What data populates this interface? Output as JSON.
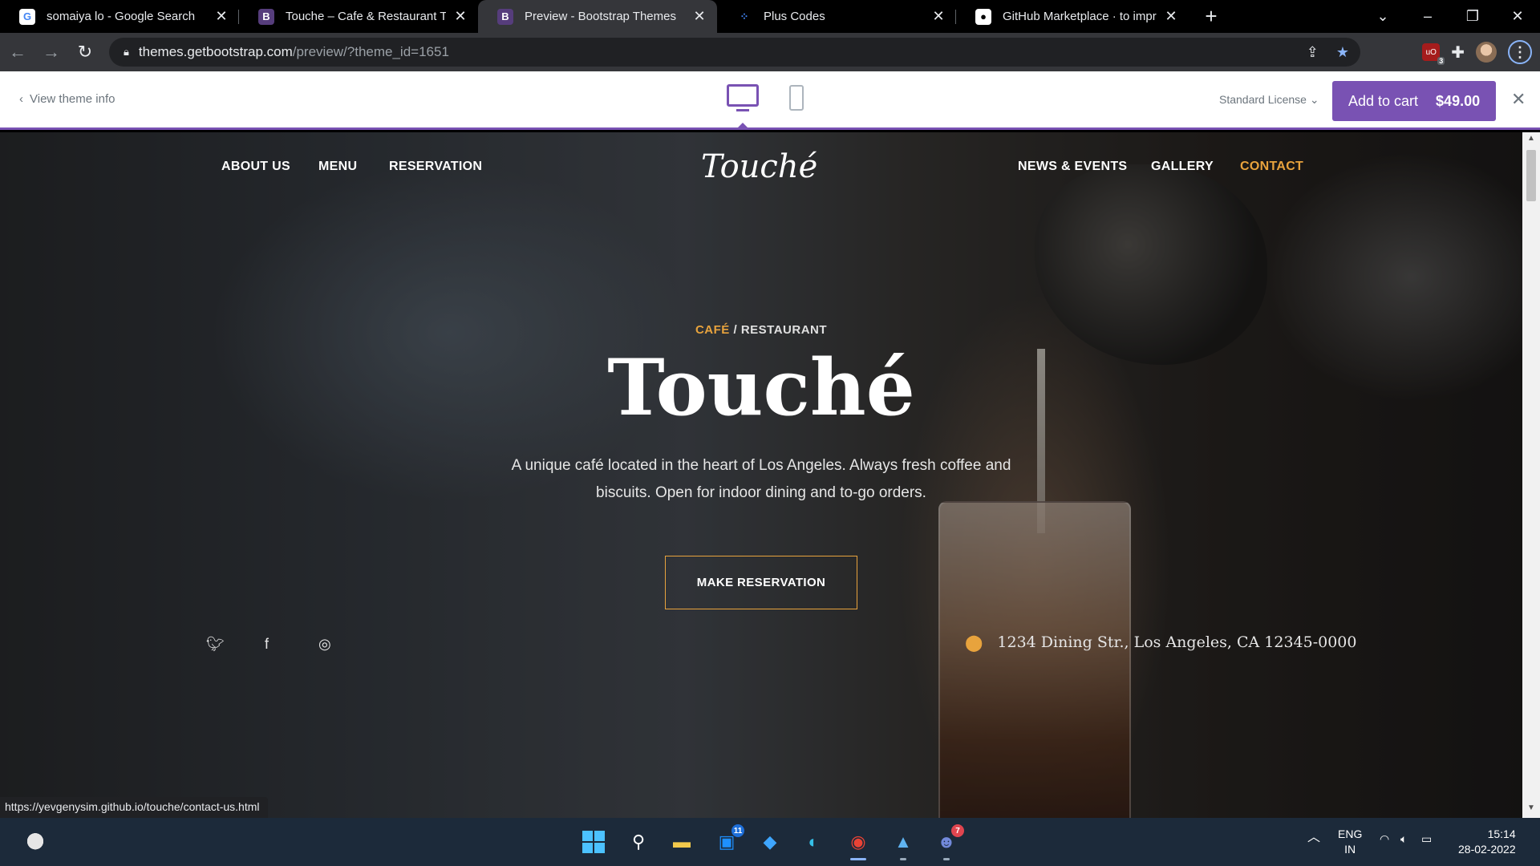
{
  "browser": {
    "tabs": [
      {
        "title": "somaiya lo - Google Search",
        "favicon": "google-icon"
      },
      {
        "title": "Touche – Cafe & Restaurant Theme",
        "favicon": "bootstrap-icon"
      },
      {
        "title": "Preview - Bootstrap Themes",
        "favicon": "bootstrap-icon",
        "active": true
      },
      {
        "title": "Plus Codes",
        "favicon": "plus-codes-icon"
      },
      {
        "title": "GitHub Marketplace · to improve",
        "favicon": "github-icon"
      }
    ],
    "url_host": "themes.getbootstrap.com",
    "url_path": "/preview/?theme_id=1651",
    "extension_badge": "3",
    "status_url": "https://yevgenysim.github.io/touche/contact-us.html"
  },
  "preview_bar": {
    "view_info": "View theme info",
    "license": "Standard License",
    "cart_label": "Add to cart",
    "price": "$49.00",
    "accent_color": "#7952b3"
  },
  "site": {
    "logo": "Touché",
    "nav_left": [
      "ABOUT US",
      "MENU",
      "RESERVATION"
    ],
    "nav_right": [
      "NEWS & EVENTS",
      "GALLERY",
      "CONTACT"
    ],
    "active_nav": "CONTACT",
    "accent_color": "#e8a33d",
    "eyebrow_a": "CAFÉ",
    "eyebrow_sep": " / ",
    "eyebrow_b": "RESTAURANT",
    "title": "Touché",
    "lead": "A unique café located in the heart of Los Angeles. Always fresh coffee and biscuits. Open for indoor dining and to-go orders.",
    "cta": "MAKE RESERVATION",
    "social": [
      "twitter-icon",
      "facebook-icon",
      "instagram-icon"
    ],
    "address": "1234 Dining Str., Los Angeles, CA 12345-0000"
  },
  "taskbar": {
    "badges": {
      "store": "11",
      "discord": "7"
    },
    "lang_top": "ENG",
    "lang_bottom": "IN",
    "time": "15:14",
    "date": "28-02-2022"
  }
}
